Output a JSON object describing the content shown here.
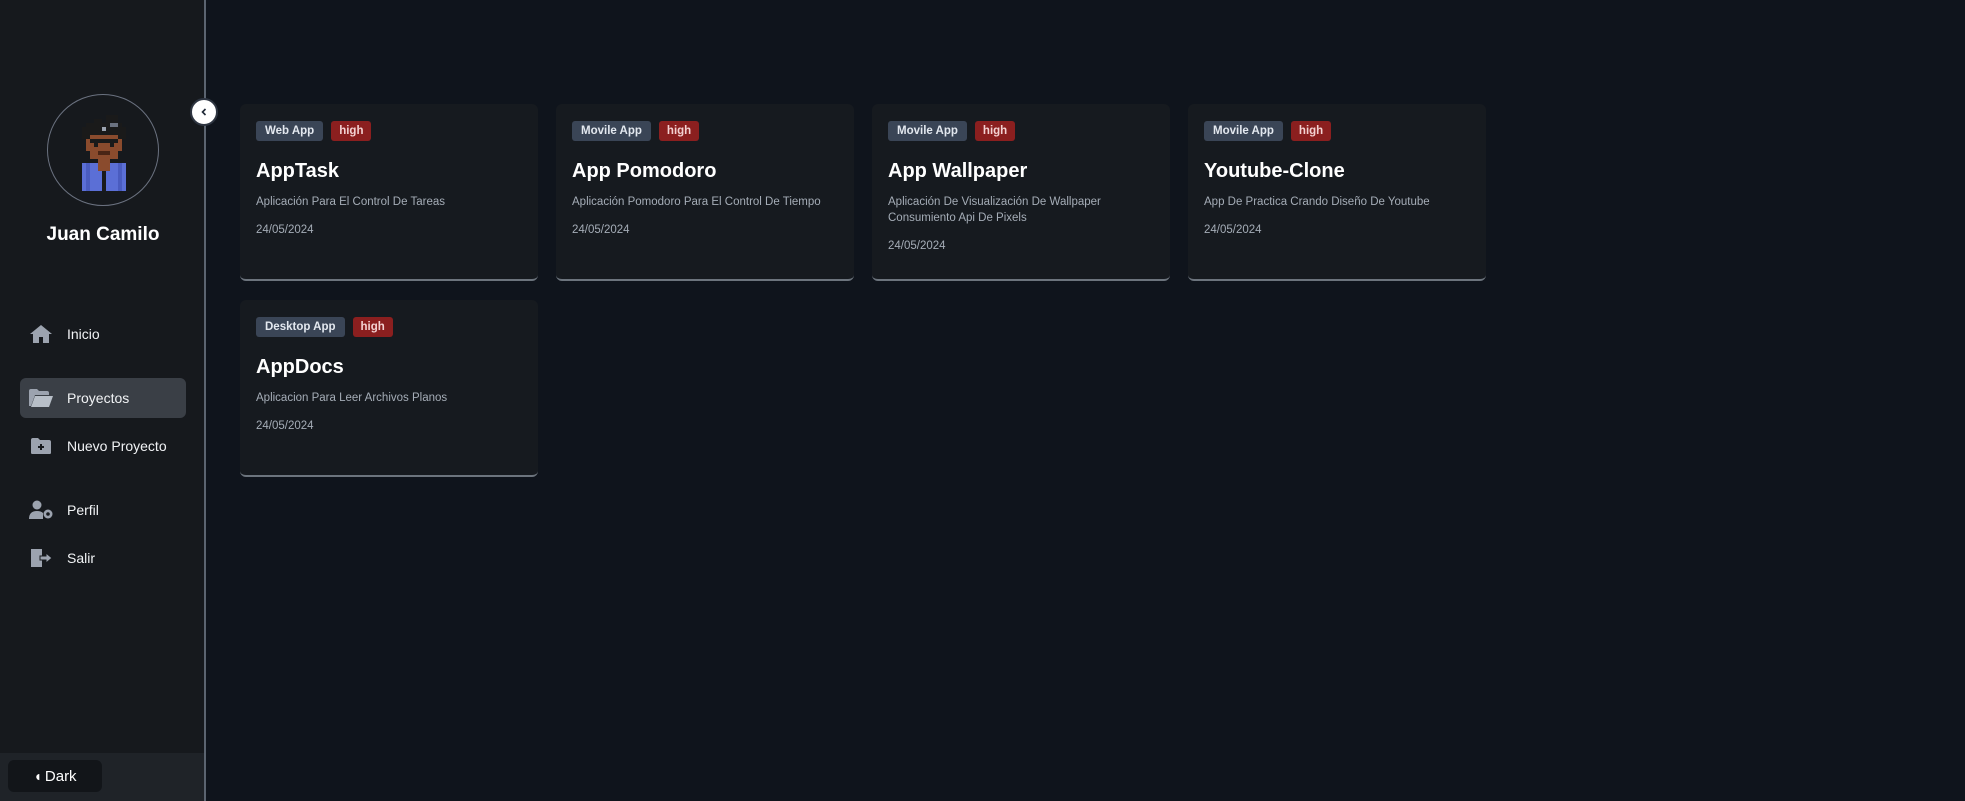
{
  "sidebar": {
    "user_name": "Juan Camilo",
    "nav": [
      {
        "label": "Inicio",
        "icon": "home-icon"
      },
      {
        "label": "Proyectos",
        "icon": "folder-open-icon",
        "active": true
      },
      {
        "label": "Nuevo Proyecto",
        "icon": "folder-plus-icon"
      },
      {
        "label": "Perfil",
        "icon": "user-gear-icon"
      },
      {
        "label": "Salir",
        "icon": "logout-icon"
      }
    ],
    "theme_label": "Dark"
  },
  "projects": [
    {
      "type": "Web App",
      "priority": "high",
      "title": "AppTask",
      "description": "Aplicación Para El Control De Tareas",
      "date": "24/05/2024"
    },
    {
      "type": "Movile App",
      "priority": "high",
      "title": "App Pomodoro",
      "description": "Aplicación Pomodoro Para El Control De Tiempo",
      "date": "24/05/2024"
    },
    {
      "type": "Movile App",
      "priority": "high",
      "title": "App Wallpaper",
      "description": "Aplicación De Visualización De Wallpaper Consumiento Api De Pixels",
      "date": "24/05/2024"
    },
    {
      "type": "Movile App",
      "priority": "high",
      "title": "Youtube-Clone",
      "description": "App De Practica Crando Diseño De Youtube",
      "date": "24/05/2024"
    },
    {
      "type": "Desktop App",
      "priority": "high",
      "title": "AppDocs",
      "description": "Aplicacion Para Leer Archivos Planos",
      "date": "24/05/2024"
    }
  ],
  "colors": {
    "background": "#0f141c",
    "sidebar": "#16191d",
    "card": "#161a1f",
    "tag_type": "#3a4556",
    "tag_priority": "#8b1f1f"
  }
}
